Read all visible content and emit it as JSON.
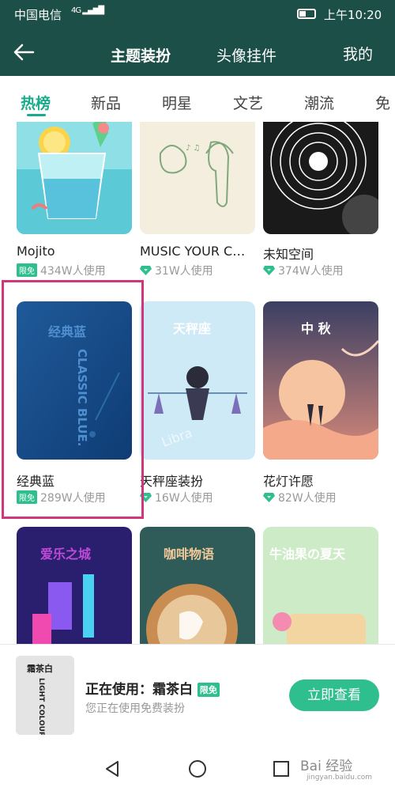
{
  "status_bar": {
    "carrier": "中国电信",
    "network": "4G",
    "time": "上午10:20"
  },
  "header": {
    "tabs": [
      "主题装扮",
      "头像挂件"
    ],
    "mine": "我的"
  },
  "categories": [
    "热榜",
    "新品",
    "明星",
    "文艺",
    "潮流",
    "免"
  ],
  "themes": [
    {
      "name": "Mojito",
      "badge": "限免",
      "users": "434W人使用"
    },
    {
      "name": "MUSIC YOUR C…",
      "users": "31W人使用"
    },
    {
      "name": "未知空间",
      "users": "374W人使用"
    },
    {
      "name": "经典蓝",
      "badge": "限免",
      "users": "289W人使用",
      "art_title": "经典蓝",
      "art_sub": "CLASSIC BLUE."
    },
    {
      "name": "天秤座装扮",
      "users": "16W人使用",
      "art_title": "天秤座",
      "art_sub": "Libra"
    },
    {
      "name": "花灯许愿",
      "users": "82W人使用",
      "art_title": "中 秋"
    },
    {
      "art_title": "爱乐之城"
    },
    {
      "art_title": "咖啡物语"
    },
    {
      "art_title": "牛油果の夏天"
    }
  ],
  "current": {
    "title": "正在使用：霜茶白",
    "badge": "限免",
    "subtitle": "您正在使用免费装扮",
    "button": "立即查看",
    "art_title": "霜茶白",
    "art_sub": "LIGHT COLOUR."
  },
  "watermark": {
    "main": "Bai 经验",
    "sub": "jingyan.baidu.com"
  },
  "colors": {
    "primary": "#1b4f47",
    "accent": "#1aab8a",
    "highlight": "#d2367a"
  }
}
